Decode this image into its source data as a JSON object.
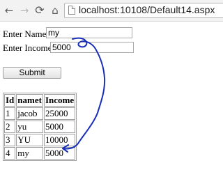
{
  "browser": {
    "url": "localhost:10108/Default14.aspx",
    "icons": {
      "back": "back-arrow-icon",
      "forward": "forward-arrow-icon",
      "reload": "reload-icon",
      "home": "home-icon",
      "page": "page-icon"
    }
  },
  "form": {
    "name_label": "Enter Name :",
    "name_value": "my",
    "income_label": "Enter Income:",
    "income_value": "5000",
    "submit_label": "Submit"
  },
  "table": {
    "headers": [
      "Id",
      "namet",
      "Income"
    ],
    "rows": [
      [
        "1",
        "jacob",
        "25000"
      ],
      [
        "2",
        "yu",
        "5000"
      ],
      [
        "3",
        "YU",
        "10000"
      ],
      [
        "4",
        "my",
        "5000"
      ]
    ]
  },
  "annotation_color": "#1a2fb8"
}
